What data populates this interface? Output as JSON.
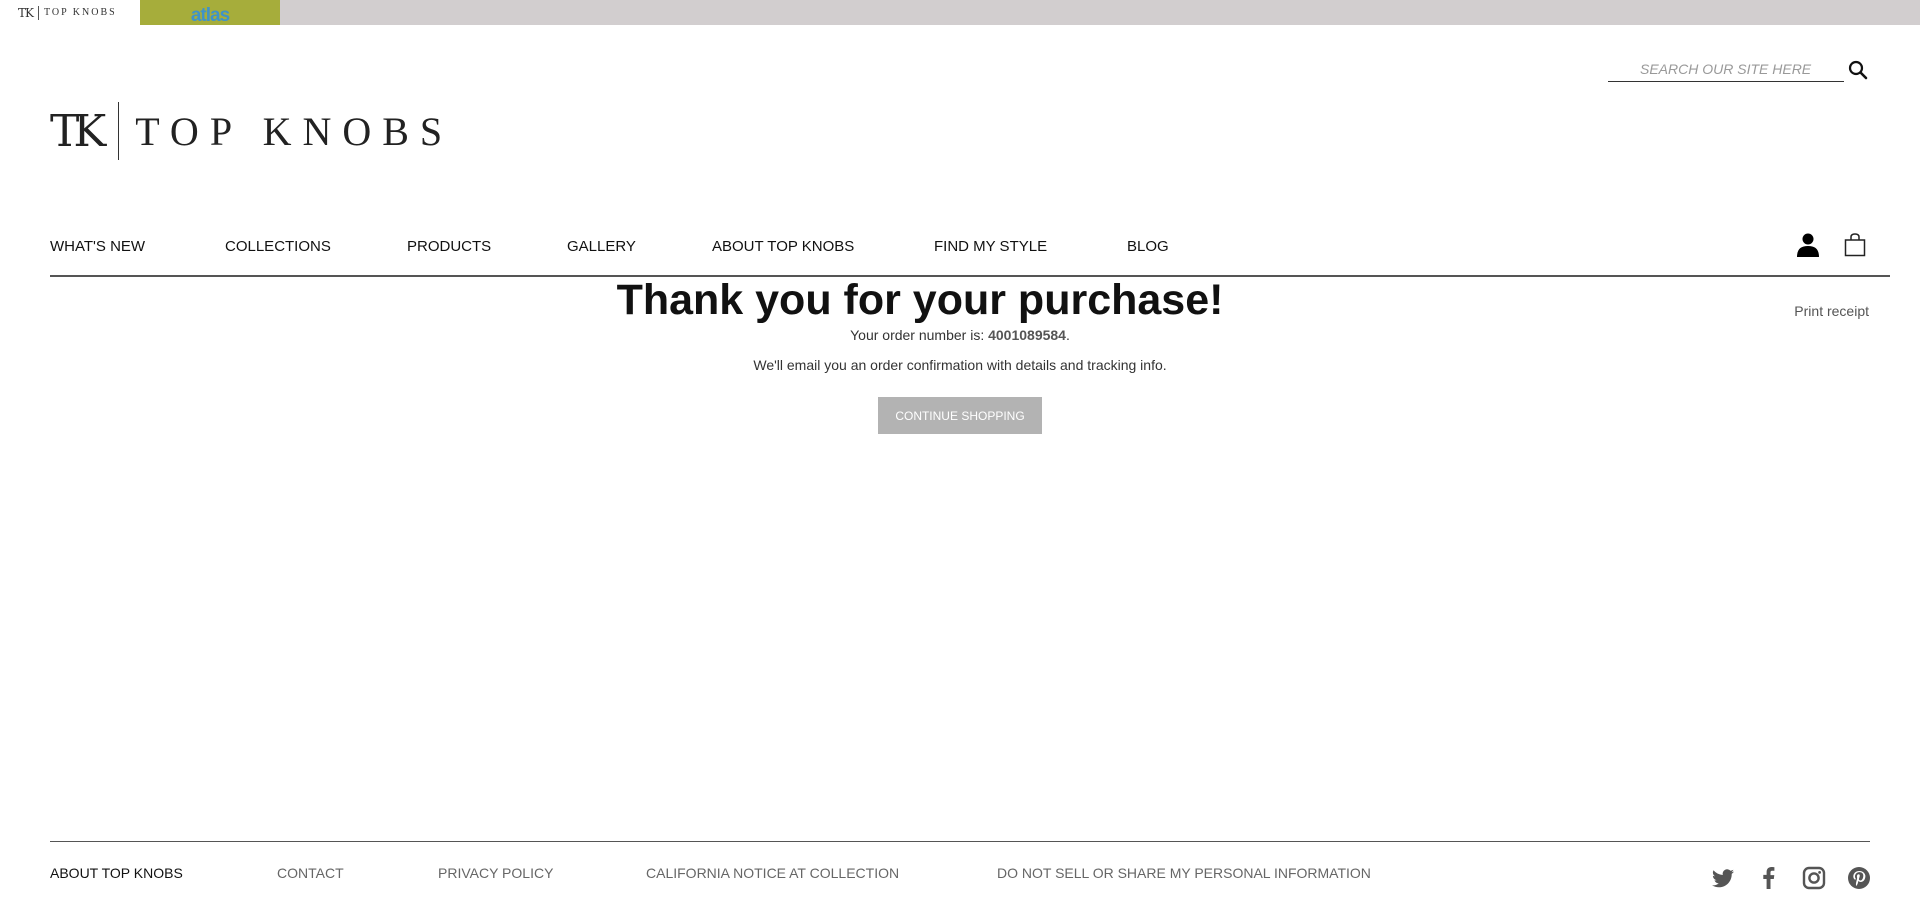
{
  "brand_strip": {
    "topknobs_monogram": "TK",
    "topknobs_word": "TOP KNOBS",
    "atlas_word": "atlas",
    "atlas_bg": "#a6ad3b",
    "atlas_text_color": "#3f93c9"
  },
  "header": {
    "search_placeholder": "SEARCH OUR SITE HERE",
    "search_icon": "magnifier-icon",
    "logo": {
      "monogram": "TK",
      "wordmark": "TOP KNOBS"
    }
  },
  "nav": {
    "items": [
      {
        "label": "WHAT'S NEW"
      },
      {
        "label": "COLLECTIONS"
      },
      {
        "label": "PRODUCTS"
      },
      {
        "label": "GALLERY"
      },
      {
        "label": "ABOUT TOP KNOBS"
      },
      {
        "label": "FIND MY STYLE"
      },
      {
        "label": "BLOG"
      }
    ],
    "account_icon": "account-icon",
    "cart_icon": "shopping-bag-icon"
  },
  "confirmation": {
    "title": "Thank you for your purchase!",
    "print_label": "Print receipt",
    "order_prefix": "Your order number is: ",
    "order_number": "4001089584",
    "order_suffix": ".",
    "email_message": "We'll email you an order confirmation with details and tracking info.",
    "continue_label": "CONTINUE SHOPPING",
    "button_color": "#b3b3b3"
  },
  "footer": {
    "links": [
      {
        "label": "ABOUT TOP KNOBS"
      },
      {
        "label": "CONTACT"
      },
      {
        "label": "PRIVACY POLICY"
      },
      {
        "label": "CALIFORNIA NOTICE AT COLLECTION"
      },
      {
        "label": "DO NOT SELL OR SHARE MY PERSONAL INFORMATION"
      }
    ],
    "social_icons": [
      "twitter-icon",
      "facebook-icon",
      "instagram-icon",
      "pinterest-icon"
    ]
  }
}
